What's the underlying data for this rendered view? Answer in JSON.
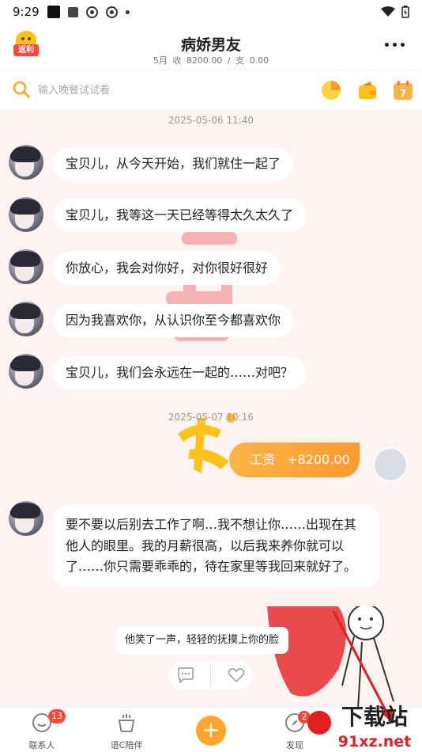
{
  "status_bar": {
    "time": "9:29"
  },
  "header": {
    "refund_label": "返利",
    "title": "病娇男友",
    "subtitle": "5月 收 8200.00 / 支 0.00"
  },
  "search": {
    "placeholder": "输入晚餐试试看"
  },
  "chat": {
    "timestamps": [
      "2025-05-06  11:40",
      "2025-05-07  10:16"
    ],
    "messages": [
      "宝贝儿，从今天开始，我们就住一起了",
      "宝贝儿，我等这一天已经等得太久太久了",
      "你放心，我会对你好，对你很好很好",
      "因为我喜欢你，从认识你至今都喜欢你",
      "宝贝儿，我们会永远在一起的……对吧？"
    ],
    "salary": {
      "label": "工资",
      "amount": "+8200.00"
    },
    "long_message": "要不要以后别去工作了啊…我不想让你……出现在其他人的眼里。我的月薪很高，以后我来养你就可以了……你只需要乖乖的，待在家里等我回来就好了。",
    "narration": "他笑了一声，轻轻的抚摸上你的脸"
  },
  "bottom_nav": {
    "items": [
      {
        "label": "联系人",
        "badge": "13"
      },
      {
        "label": "语C陪伴"
      },
      {
        "label": "发现",
        "badge": "2"
      }
    ],
    "plus_label": "+"
  },
  "watermark": {
    "title": "下载站",
    "domain": "91xz.net"
  },
  "colors": {
    "accent": "#ffa62b",
    "badge": "#ff4a3a",
    "background": "#fdf3f3"
  }
}
